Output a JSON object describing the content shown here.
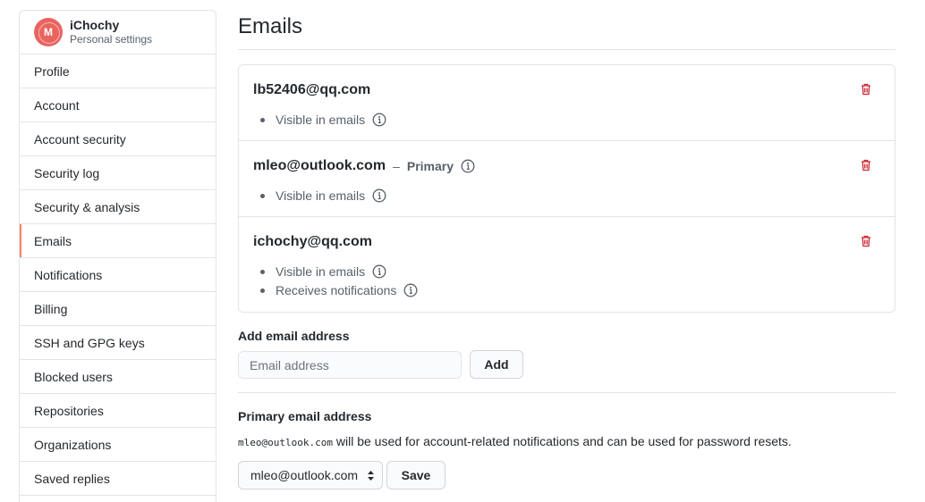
{
  "user": {
    "name": "iChochy",
    "subtitle": "Personal settings",
    "avatar_letter": "M",
    "avatar_color": "#e9645f"
  },
  "sidebar": {
    "items": [
      {
        "label": "Profile",
        "selected": false
      },
      {
        "label": "Account",
        "selected": false
      },
      {
        "label": "Account security",
        "selected": false
      },
      {
        "label": "Security log",
        "selected": false
      },
      {
        "label": "Security & analysis",
        "selected": false
      },
      {
        "label": "Emails",
        "selected": true
      },
      {
        "label": "Notifications",
        "selected": false
      },
      {
        "label": "Billing",
        "selected": false
      },
      {
        "label": "SSH and GPG keys",
        "selected": false
      },
      {
        "label": "Blocked users",
        "selected": false
      },
      {
        "label": "Repositories",
        "selected": false
      },
      {
        "label": "Organizations",
        "selected": false
      },
      {
        "label": "Saved replies",
        "selected": false
      }
    ],
    "selected_accent": "#f9826c"
  },
  "page": {
    "title": "Emails"
  },
  "emails": [
    {
      "address": "lb52406@qq.com",
      "primary": false,
      "bullets": [
        "Visible in emails"
      ]
    },
    {
      "address": "mleo@outlook.com",
      "primary": true,
      "primary_dash": "–",
      "primary_label": "Primary",
      "bullets": [
        "Visible in emails"
      ]
    },
    {
      "address": "ichochy@qq.com",
      "primary": false,
      "bullets": [
        "Visible in emails",
        "Receives notifications"
      ]
    }
  ],
  "add_email": {
    "label": "Add email address",
    "placeholder": "Email address",
    "button": "Add"
  },
  "primary_section": {
    "label": "Primary email address",
    "note_code": "mleo@outlook.com",
    "note_text": " will be used for account-related notifications and can be used for password resets.",
    "selected": "mleo@outlook.com",
    "save": "Save"
  },
  "colors": {
    "trash": "#cb2431",
    "border": "#e1e4e8",
    "muted": "#586069"
  },
  "icons": {
    "info": "info-icon",
    "trash": "trash-icon",
    "caret": "select-caret-icon"
  }
}
